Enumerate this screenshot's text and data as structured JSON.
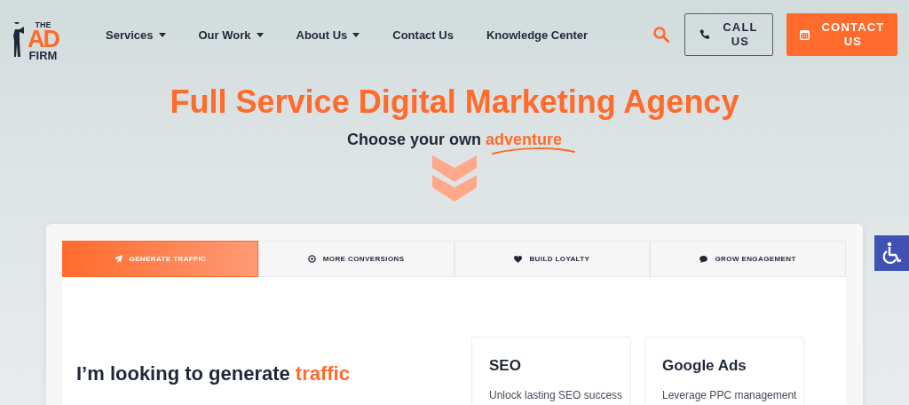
{
  "logo": {
    "top": "THE",
    "middle": "AD",
    "bottom": "FIRM"
  },
  "nav": [
    {
      "label": "Services",
      "dropdown": true
    },
    {
      "label": "Our Work",
      "dropdown": true
    },
    {
      "label": "About Us",
      "dropdown": true
    },
    {
      "label": "Contact Us",
      "dropdown": false
    },
    {
      "label": "Knowledge Center",
      "dropdown": false
    }
  ],
  "call_button": {
    "line1": "CALL",
    "line2": "US"
  },
  "contact_button": {
    "line1": "CONTACT",
    "line2": "US"
  },
  "hero": {
    "title": "Full Service Digital Marketing Agency",
    "subtitle": "Choose your own",
    "subtitle_highlight": "adventure"
  },
  "tabs": [
    {
      "label": "GENERATE TRAFFIC",
      "kind": "plane",
      "selected": true
    },
    {
      "label": "MORE CONVERSIONS",
      "kind": "target",
      "selected": false
    },
    {
      "label": "BUILD LOYALTY",
      "kind": "heart",
      "selected": false
    },
    {
      "label": "GROW ENGAGEMENT",
      "kind": "chat",
      "selected": false
    }
  ],
  "panel": {
    "heading": "I’m looking to generate",
    "heading_highlight": "traffic",
    "cards": [
      {
        "title": "SEO",
        "text": "Unlock lasting SEO success"
      },
      {
        "title": "Google Ads",
        "text": "Leverage PPC management"
      }
    ]
  }
}
